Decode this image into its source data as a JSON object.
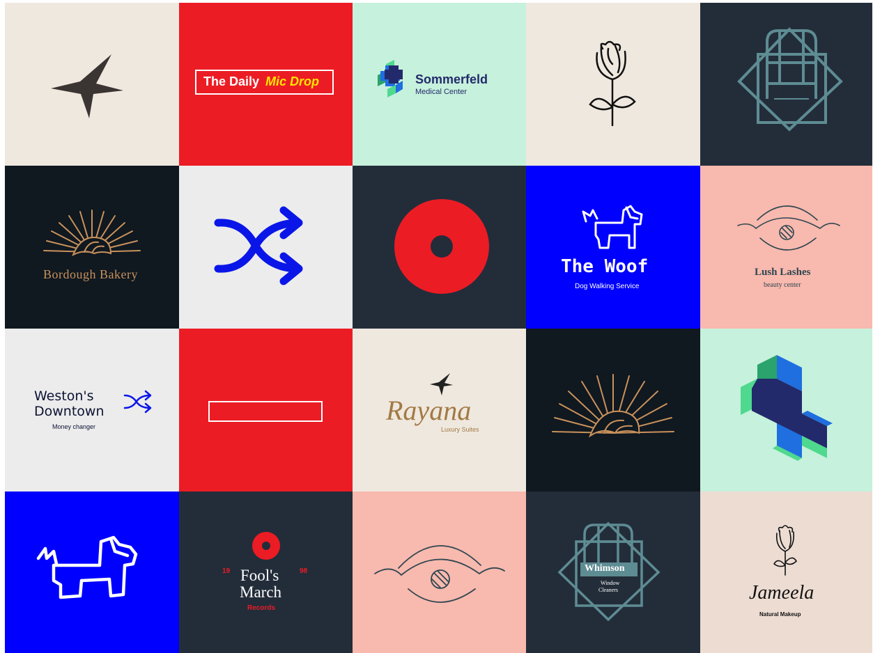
{
  "colors": {
    "cream": "#efe8df",
    "red": "#ec1c24",
    "mint": "#c6f1dc",
    "navy": "#232d3a",
    "black": "#101820",
    "light_gray": "#ececec",
    "blue": "#0000ff",
    "pink": "#f8b9ae",
    "beige": "#ecdcd2",
    "gold": "#c9925b",
    "teal": "#5e8c93",
    "indigo": "#232a6b",
    "yellow": "#ffe500"
  },
  "tiles": {
    "daily_mic_drop": {
      "the_daily": "The Daily",
      "mic_drop": "Mic Drop"
    },
    "sommerfeld": {
      "name": "Sommerfeld",
      "sub": "Medical Center"
    },
    "bordough": {
      "name": "Bordough Bakery"
    },
    "woof": {
      "name": "The Woof",
      "sub": "Dog Walking Service"
    },
    "lush_lashes": {
      "name": "Lush Lashes",
      "sub": "beauty center"
    },
    "westons": {
      "line1": "Weston's",
      "line2": "Downtown",
      "sub": "Money changer"
    },
    "rayana": {
      "name": "Rayana",
      "sub": "Luxury Suites"
    },
    "fools_march": {
      "year_left": "19",
      "year_right": "98",
      "line1": "Fool's",
      "line2": "March",
      "sub": "Records"
    },
    "whimson": {
      "name": "Whimson",
      "sub1": "Window",
      "sub2": "Cleaners"
    },
    "jameela": {
      "name": "Jameela",
      "sub": "Natural Makeup"
    }
  }
}
